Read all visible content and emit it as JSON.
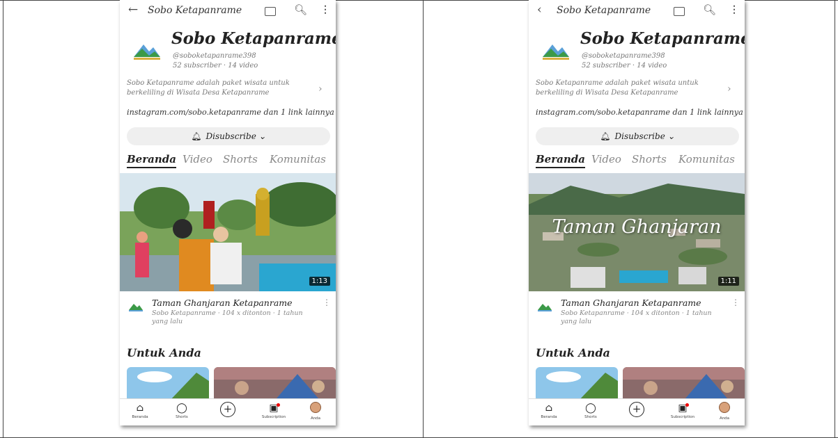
{
  "screens": [
    {
      "topbar": {
        "back_icon": "←",
        "title": "Sobo Ketapanrame"
      },
      "channel": {
        "name": "Sobo Ketapanrame",
        "handle": "@soboketapanrame398",
        "stats": "52 subscriber · 14 video",
        "description": "Sobo Ketapanrame adalah paket wisata untuk berkeliling di Wisata Desa Ketapanrame",
        "links": "instagram.com/sobo.ketapanrame dan 1 link lainnya",
        "subscribe_label": "Disubscribe"
      },
      "tabs": [
        "Beranda",
        "Video",
        "Shorts",
        "Komunitas"
      ],
      "video": {
        "duration": "1:13",
        "overlay_text": "",
        "title": "Taman Ghanjaran Ketapanrame",
        "meta": "Sobo Ketapanrame · 104 x ditonton · 1 tahun yang lalu"
      },
      "section_title": "Untuk Anda",
      "nav": [
        {
          "label": "Beranda",
          "icon": "home-icon"
        },
        {
          "label": "Shorts",
          "icon": "shorts-icon"
        },
        {
          "label": "",
          "icon": "create-icon"
        },
        {
          "label": "Subscription",
          "icon": "subscriptions-icon"
        },
        {
          "label": "Anda",
          "icon": "avatar-icon"
        }
      ]
    },
    {
      "topbar": {
        "back_icon": "‹",
        "title": "Sobo Ketapanrame"
      },
      "channel": {
        "name": "Sobo Ketapanrame",
        "handle": "@soboketapanrame398",
        "stats": "52 subscriber · 14 video",
        "description": "Sobo Ketapanrame adalah paket wisata untuk berkeliling di Wisata Desa Ketapanrame",
        "links": "instagram.com/sobo.ketapanrame dan 1 link lainnya",
        "subscribe_label": "Disubscribe"
      },
      "tabs": [
        "Beranda",
        "Video",
        "Shorts",
        "Komunitas"
      ],
      "video": {
        "duration": "1:11",
        "overlay_text": "Taman Ghanjaran",
        "title": "Taman Ghanjaran Ketapanrame",
        "meta": "Sobo Ketapanrame · 104 x ditonton · 1 tahun yang lalu"
      },
      "section_title": "Untuk Anda",
      "nav": [
        {
          "label": "Beranda",
          "icon": "home-icon"
        },
        {
          "label": "Shorts",
          "icon": "shorts-icon"
        },
        {
          "label": "",
          "icon": "create-icon"
        },
        {
          "label": "Subscription",
          "icon": "subscriptions-icon"
        },
        {
          "label": "Anda",
          "icon": "avatar-icon"
        }
      ]
    }
  ],
  "colors": {
    "accent": "#e00000",
    "subscribe_bg": "#efefef"
  }
}
